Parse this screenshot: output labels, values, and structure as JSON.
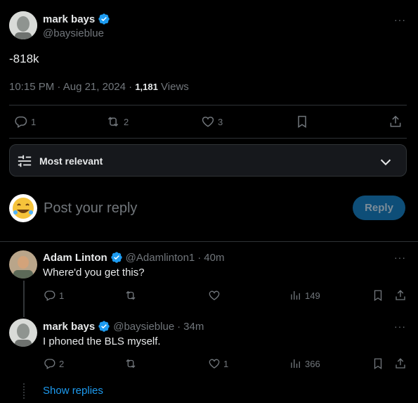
{
  "tweet": {
    "author_name": "mark bays",
    "author_handle": "@baysieblue",
    "text": "-818k",
    "time": "10:15 PM",
    "date_sep": " · ",
    "date": "Aug 21, 2024",
    "views_sep": " · ",
    "views_count": "1,181",
    "views_label": " Views",
    "replies": "1",
    "retweets": "2",
    "likes": "3"
  },
  "sort": {
    "label": "Most relevant"
  },
  "composer": {
    "placeholder": "Post your reply",
    "button": "Reply"
  },
  "replies": [
    {
      "name": "Adam Linton",
      "handle": "@Adamlinton1",
      "sep": " · ",
      "time": "40m",
      "text": "Where'd you get this?",
      "replies": "1",
      "retweets": "",
      "likes": "",
      "views": "149"
    },
    {
      "name": "mark bays",
      "handle": "@baysieblue",
      "sep": " · ",
      "time": "34m",
      "text": "I phoned the BLS myself.",
      "replies": "2",
      "retweets": "",
      "likes": "1",
      "views": "366"
    }
  ],
  "show_replies": "Show replies",
  "colors": {
    "accent": "#1d9bf0",
    "reply_button_bg": "#0e4e78",
    "reply_button_text": "#7c8c98",
    "divider": "#2f3336",
    "muted": "#71767b"
  }
}
